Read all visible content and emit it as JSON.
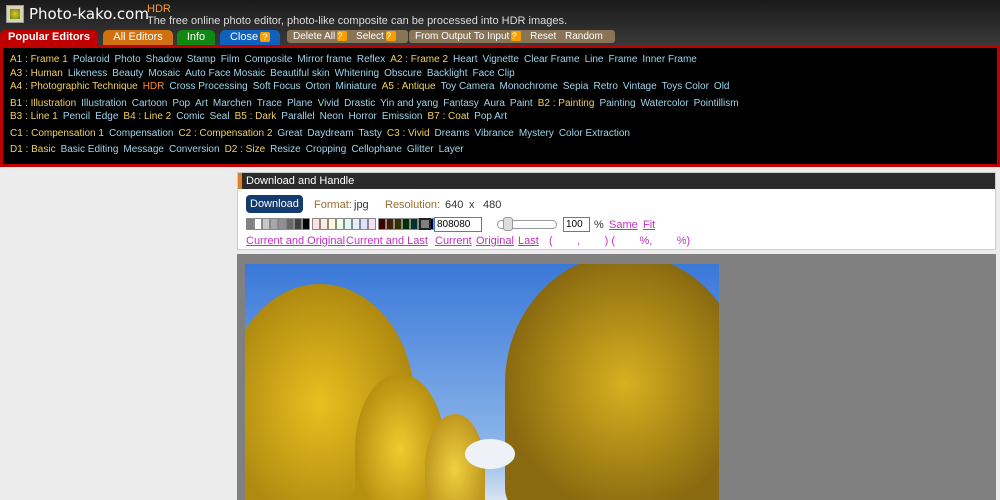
{
  "header": {
    "site": "Photo-kako.com",
    "page": "HDR",
    "description": "The free online photo editor, photo-like composite can be processed into HDR images."
  },
  "tabs": [
    {
      "label": "Popular Editors",
      "color": "#c00000"
    },
    {
      "label": "All Editors",
      "color": "#d07010"
    },
    {
      "label": "Info",
      "color": "#118811"
    },
    {
      "label": "Close",
      "color": "#1060c0"
    }
  ],
  "toolbar": {
    "delete_all": "Delete All",
    "select": "Select",
    "from_output": "From Output To Input",
    "reset": "Reset",
    "random": "Random",
    "help": "?"
  },
  "menu": [
    [
      {
        "t": "A1 : Frame 1",
        "c": 1
      },
      {
        "t": "Polaroid"
      },
      {
        "t": "Photo"
      },
      {
        "t": "Shadow"
      },
      {
        "t": "Stamp"
      },
      {
        "t": "Film"
      },
      {
        "t": "Composite"
      },
      {
        "t": "Mirror frame"
      },
      {
        "t": "Reflex"
      },
      {
        "t": "A2 : Frame 2",
        "c": 1
      },
      {
        "t": "Heart"
      },
      {
        "t": "Vignette"
      },
      {
        "t": "Clear Frame"
      },
      {
        "t": "Line"
      },
      {
        "t": "Frame"
      },
      {
        "t": "Inner Frame"
      }
    ],
    [
      {
        "t": "A3 : Human",
        "c": 1
      },
      {
        "t": "Likeness"
      },
      {
        "t": "Beauty"
      },
      {
        "t": "Mosaic"
      },
      {
        "t": "Auto Face Mosaic"
      },
      {
        "t": "Beautiful skin"
      },
      {
        "t": "Whitening"
      },
      {
        "t": "Obscure"
      },
      {
        "t": "Backlight"
      },
      {
        "t": "Face Clip"
      }
    ],
    [
      {
        "t": "A4 : Photographic Technique",
        "c": 1
      },
      {
        "t": "HDR",
        "cur": 1
      },
      {
        "t": "Cross Processing"
      },
      {
        "t": "Soft Focus"
      },
      {
        "t": "Orton"
      },
      {
        "t": "Miniature"
      },
      {
        "t": "A5 : Antique",
        "c": 1
      },
      {
        "t": "Toy Camera"
      },
      {
        "t": "Monochrome"
      },
      {
        "t": "Sepia"
      },
      {
        "t": "Retro"
      },
      {
        "t": "Vintage"
      },
      {
        "t": "Toys Color"
      },
      {
        "t": "Old"
      }
    ],
    [
      {
        "t": "B1 : Illustration",
        "c": 1,
        "g": 1
      },
      {
        "t": "Illustration"
      },
      {
        "t": "Cartoon"
      },
      {
        "t": "Pop"
      },
      {
        "t": "Art"
      },
      {
        "t": "Marchen"
      },
      {
        "t": "Trace"
      },
      {
        "t": "Plane"
      },
      {
        "t": "Vivid"
      },
      {
        "t": "Drastic"
      },
      {
        "t": "Yin and yang"
      },
      {
        "t": "Fantasy"
      },
      {
        "t": "Aura"
      },
      {
        "t": "Paint"
      },
      {
        "t": "B2 : Painting",
        "c": 1
      },
      {
        "t": "Painting"
      },
      {
        "t": "Watercolor"
      },
      {
        "t": "Pointillism"
      }
    ],
    [
      {
        "t": "B3 : Line 1",
        "c": 1
      },
      {
        "t": "Pencil"
      },
      {
        "t": "Edge"
      },
      {
        "t": "B4 : Line 2",
        "c": 1
      },
      {
        "t": "Comic"
      },
      {
        "t": "Seal"
      },
      {
        "t": "B5 : Dark",
        "c": 1
      },
      {
        "t": "Parallel"
      },
      {
        "t": "Neon"
      },
      {
        "t": "Horror"
      },
      {
        "t": "Emission"
      },
      {
        "t": "B7 : Coat",
        "c": 1
      },
      {
        "t": "Pop Art"
      }
    ],
    [
      {
        "t": "C1 : Compensation 1",
        "c": 1,
        "g": 1
      },
      {
        "t": "Compensation"
      },
      {
        "t": "C2 : Compensation 2",
        "c": 1
      },
      {
        "t": "Great"
      },
      {
        "t": "Daydream"
      },
      {
        "t": "Tasty"
      },
      {
        "t": "C3 : Vivid",
        "c": 1
      },
      {
        "t": "Dreams"
      },
      {
        "t": "Vibrance"
      },
      {
        "t": "Mystery"
      },
      {
        "t": "Color Extraction"
      }
    ],
    [
      {
        "t": "D1 : Basic",
        "c": 1,
        "g": 1
      },
      {
        "t": "Basic Editing"
      },
      {
        "t": "Message"
      },
      {
        "t": "Conversion"
      },
      {
        "t": "D2 : Size",
        "c": 1
      },
      {
        "t": "Resize"
      },
      {
        "t": "Cropping"
      },
      {
        "t": "Cellophane"
      },
      {
        "t": "Glitter"
      },
      {
        "t": "Layer"
      }
    ]
  ],
  "panel": {
    "title": "Download and Handle",
    "download": "Download",
    "format_label": "Format:",
    "format": "jpg",
    "resolution_label": "Resolution:",
    "width": "640",
    "x": "x",
    "height": "480",
    "swatches": [
      "#808080",
      "#ffffff",
      "#c8c8c8",
      "#a8a8a8",
      "#909090",
      "#686868",
      "#404040",
      "#000000",
      "#ffe0e0",
      "#ffeadc",
      "#fff8e0",
      "#e8ffe0",
      "#e0f8f0",
      "#e0f0ff",
      "#e0e0ff",
      "#f4e0ff",
      "#400000",
      "#402000",
      "#303000",
      "#003000",
      "#003030",
      "#002040",
      "#000040",
      "#200040"
    ],
    "bg_color": "808080",
    "zoom": "100",
    "zoom_unit": "%",
    "same": "Same",
    "fit": "Fit",
    "links": [
      "Current and Original",
      "Current and Last",
      "Current",
      "Original",
      "Last"
    ],
    "coords": "(        ,        ) (        %,        %)"
  }
}
